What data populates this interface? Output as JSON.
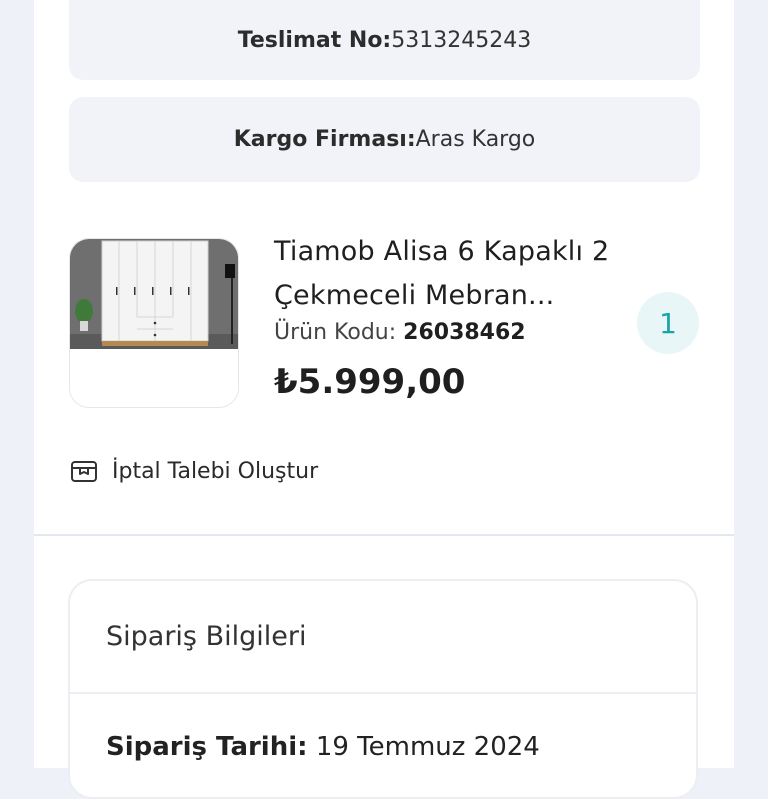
{
  "delivery": {
    "label": "Teslimat No:",
    "value": "5313245243"
  },
  "cargo": {
    "label": "Kargo Firması:",
    "value": "Aras Kargo"
  },
  "product": {
    "title_line1": "Tiamob Alisa 6 Kapaklı 2",
    "title_line2": "Çekmeceli Mebran...",
    "code_label": "Ürün Kodu:",
    "code_value": "26038462",
    "price": "₺5.999,00",
    "quantity": "1",
    "image_icon": "wardrobe-image"
  },
  "cancel": {
    "label": "İptal Talebi Oluştur",
    "icon": "box-return-icon"
  },
  "order_info": {
    "title": "Sipariş Bilgileri",
    "date_label": "Sipariş Tarihi:",
    "date_value": "19 Temmuz 2024"
  }
}
